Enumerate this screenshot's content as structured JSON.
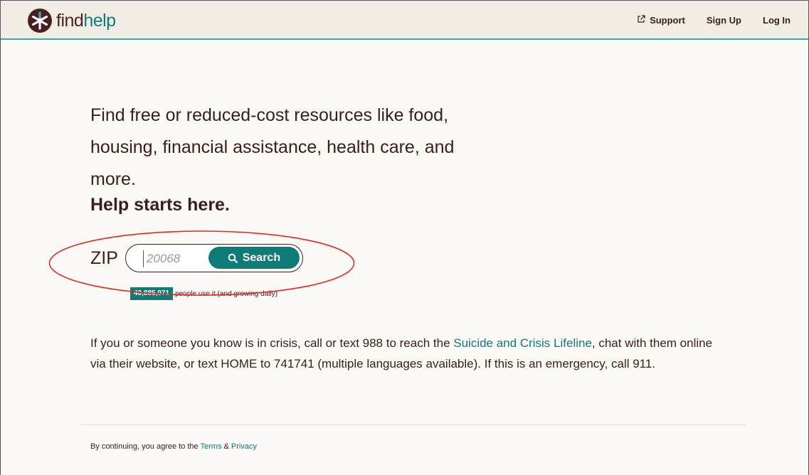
{
  "brand": {
    "name_part1": "find",
    "name_part2": "help"
  },
  "nav": {
    "support": "Support",
    "sign_up": "Sign Up",
    "log_in": "Log In"
  },
  "hero": {
    "headline": "Find free or reduced-cost resources like food, housing, financial assistance, health care, and more.",
    "strong": "Help starts here."
  },
  "search": {
    "zip_label": "ZIP",
    "placeholder": "20068",
    "button_label": "Search"
  },
  "usage": {
    "count": "40,885,071",
    "text": "people use it (and growing daily)"
  },
  "crisis": {
    "before": "If you or someone you know is in crisis, call or text 988 to reach the ",
    "link": "Suicide and Crisis Lifeline",
    "after": ", chat with them online via their website, or text HOME to 741741 (multiple languages available). If this is an emergency, call 911."
  },
  "footer": {
    "prefix": "By continuing, you agree to the ",
    "terms": "Terms",
    "amp": " & ",
    "privacy": "Privacy"
  },
  "colors": {
    "brand_dark": "#4a1f22",
    "brand_teal": "#0f7b76",
    "header_bg": "#f1ede5",
    "annotation": "#e8261e"
  },
  "icons": {
    "logo": "asterisk-logo-icon",
    "external": "external-link-icon",
    "search": "magnifier-icon"
  }
}
